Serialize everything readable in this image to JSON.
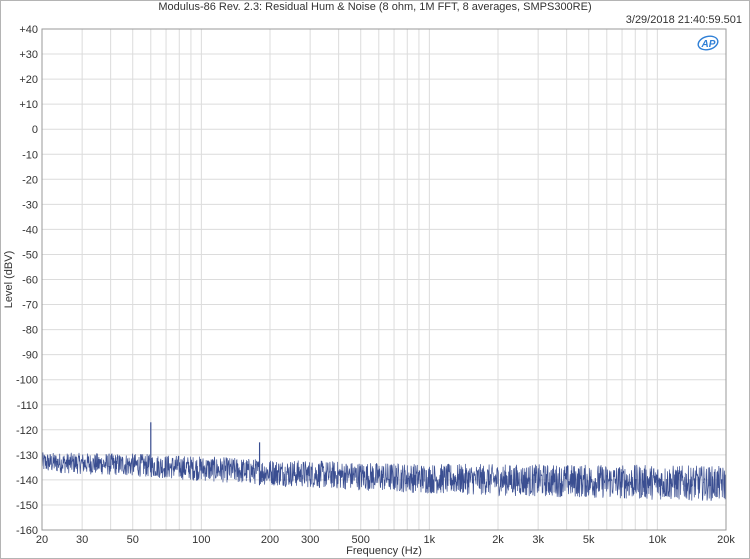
{
  "chart_data": {
    "type": "line",
    "title": "Modulus-86 Rev. 2.3: Residual Hum & Noise (8 ohm, 1M FFT, 8 averages, SMPS300RE)",
    "timestamp": "3/29/2018 21:40:59.501",
    "logo_text": "AP",
    "xlabel": "Frequency (Hz)",
    "ylabel": "Level (dBV)",
    "x_scale": "log",
    "xlim": [
      20,
      20000
    ],
    "ylim": [
      -160,
      40
    ],
    "grid": true,
    "x_ticks": [
      {
        "value": 20,
        "label": "20"
      },
      {
        "value": 30,
        "label": "30"
      },
      {
        "value": 50,
        "label": "50"
      },
      {
        "value": 100,
        "label": "100"
      },
      {
        "value": 200,
        "label": "200"
      },
      {
        "value": 300,
        "label": "300"
      },
      {
        "value": 500,
        "label": "500"
      },
      {
        "value": 1000,
        "label": "1k"
      },
      {
        "value": 2000,
        "label": "2k"
      },
      {
        "value": 3000,
        "label": "3k"
      },
      {
        "value": 5000,
        "label": "5k"
      },
      {
        "value": 10000,
        "label": "10k"
      },
      {
        "value": 20000,
        "label": "20k"
      }
    ],
    "y_ticks": [
      {
        "value": 40,
        "label": "+40"
      },
      {
        "value": 30,
        "label": "+30"
      },
      {
        "value": 20,
        "label": "+20"
      },
      {
        "value": 10,
        "label": "+10"
      },
      {
        "value": 0,
        "label": "0"
      },
      {
        "value": -10,
        "label": "-10"
      },
      {
        "value": -20,
        "label": "-20"
      },
      {
        "value": -30,
        "label": "-30"
      },
      {
        "value": -40,
        "label": "-40"
      },
      {
        "value": -50,
        "label": "-50"
      },
      {
        "value": -60,
        "label": "-60"
      },
      {
        "value": -70,
        "label": "-70"
      },
      {
        "value": -80,
        "label": "-80"
      },
      {
        "value": -90,
        "label": "-90"
      },
      {
        "value": -100,
        "label": "-100"
      },
      {
        "value": -110,
        "label": "-110"
      },
      {
        "value": -120,
        "label": "-120"
      },
      {
        "value": -130,
        "label": "-130"
      },
      {
        "value": -140,
        "label": "-140"
      },
      {
        "value": -150,
        "label": "-150"
      },
      {
        "value": -160,
        "label": "-160"
      }
    ],
    "series": [
      {
        "color": "#3a4e91",
        "floor": [
          {
            "x": 20,
            "y": -133
          },
          {
            "x": 50,
            "y": -134
          },
          {
            "x": 100,
            "y": -135.5
          },
          {
            "x": 200,
            "y": -137
          },
          {
            "x": 500,
            "y": -138.5
          },
          {
            "x": 1000,
            "y": -139.5
          },
          {
            "x": 2000,
            "y": -140
          },
          {
            "x": 5000,
            "y": -140.5
          },
          {
            "x": 10000,
            "y": -141
          },
          {
            "x": 20000,
            "y": -141.5
          }
        ],
        "noise_band": [
          {
            "x": 20,
            "y": 4
          },
          {
            "x": 100,
            "y": 5
          },
          {
            "x": 1000,
            "y": 6
          },
          {
            "x": 10000,
            "y": 7
          },
          {
            "x": 20000,
            "y": 7
          }
        ],
        "peaks": [
          {
            "x": 60,
            "y": -117
          },
          {
            "x": 180,
            "y": -125
          }
        ]
      }
    ],
    "colors": {
      "grid": "#dcdcdc",
      "axis": "#999999",
      "trace": "#3a4e91",
      "logo": "#2f7fd6"
    }
  }
}
